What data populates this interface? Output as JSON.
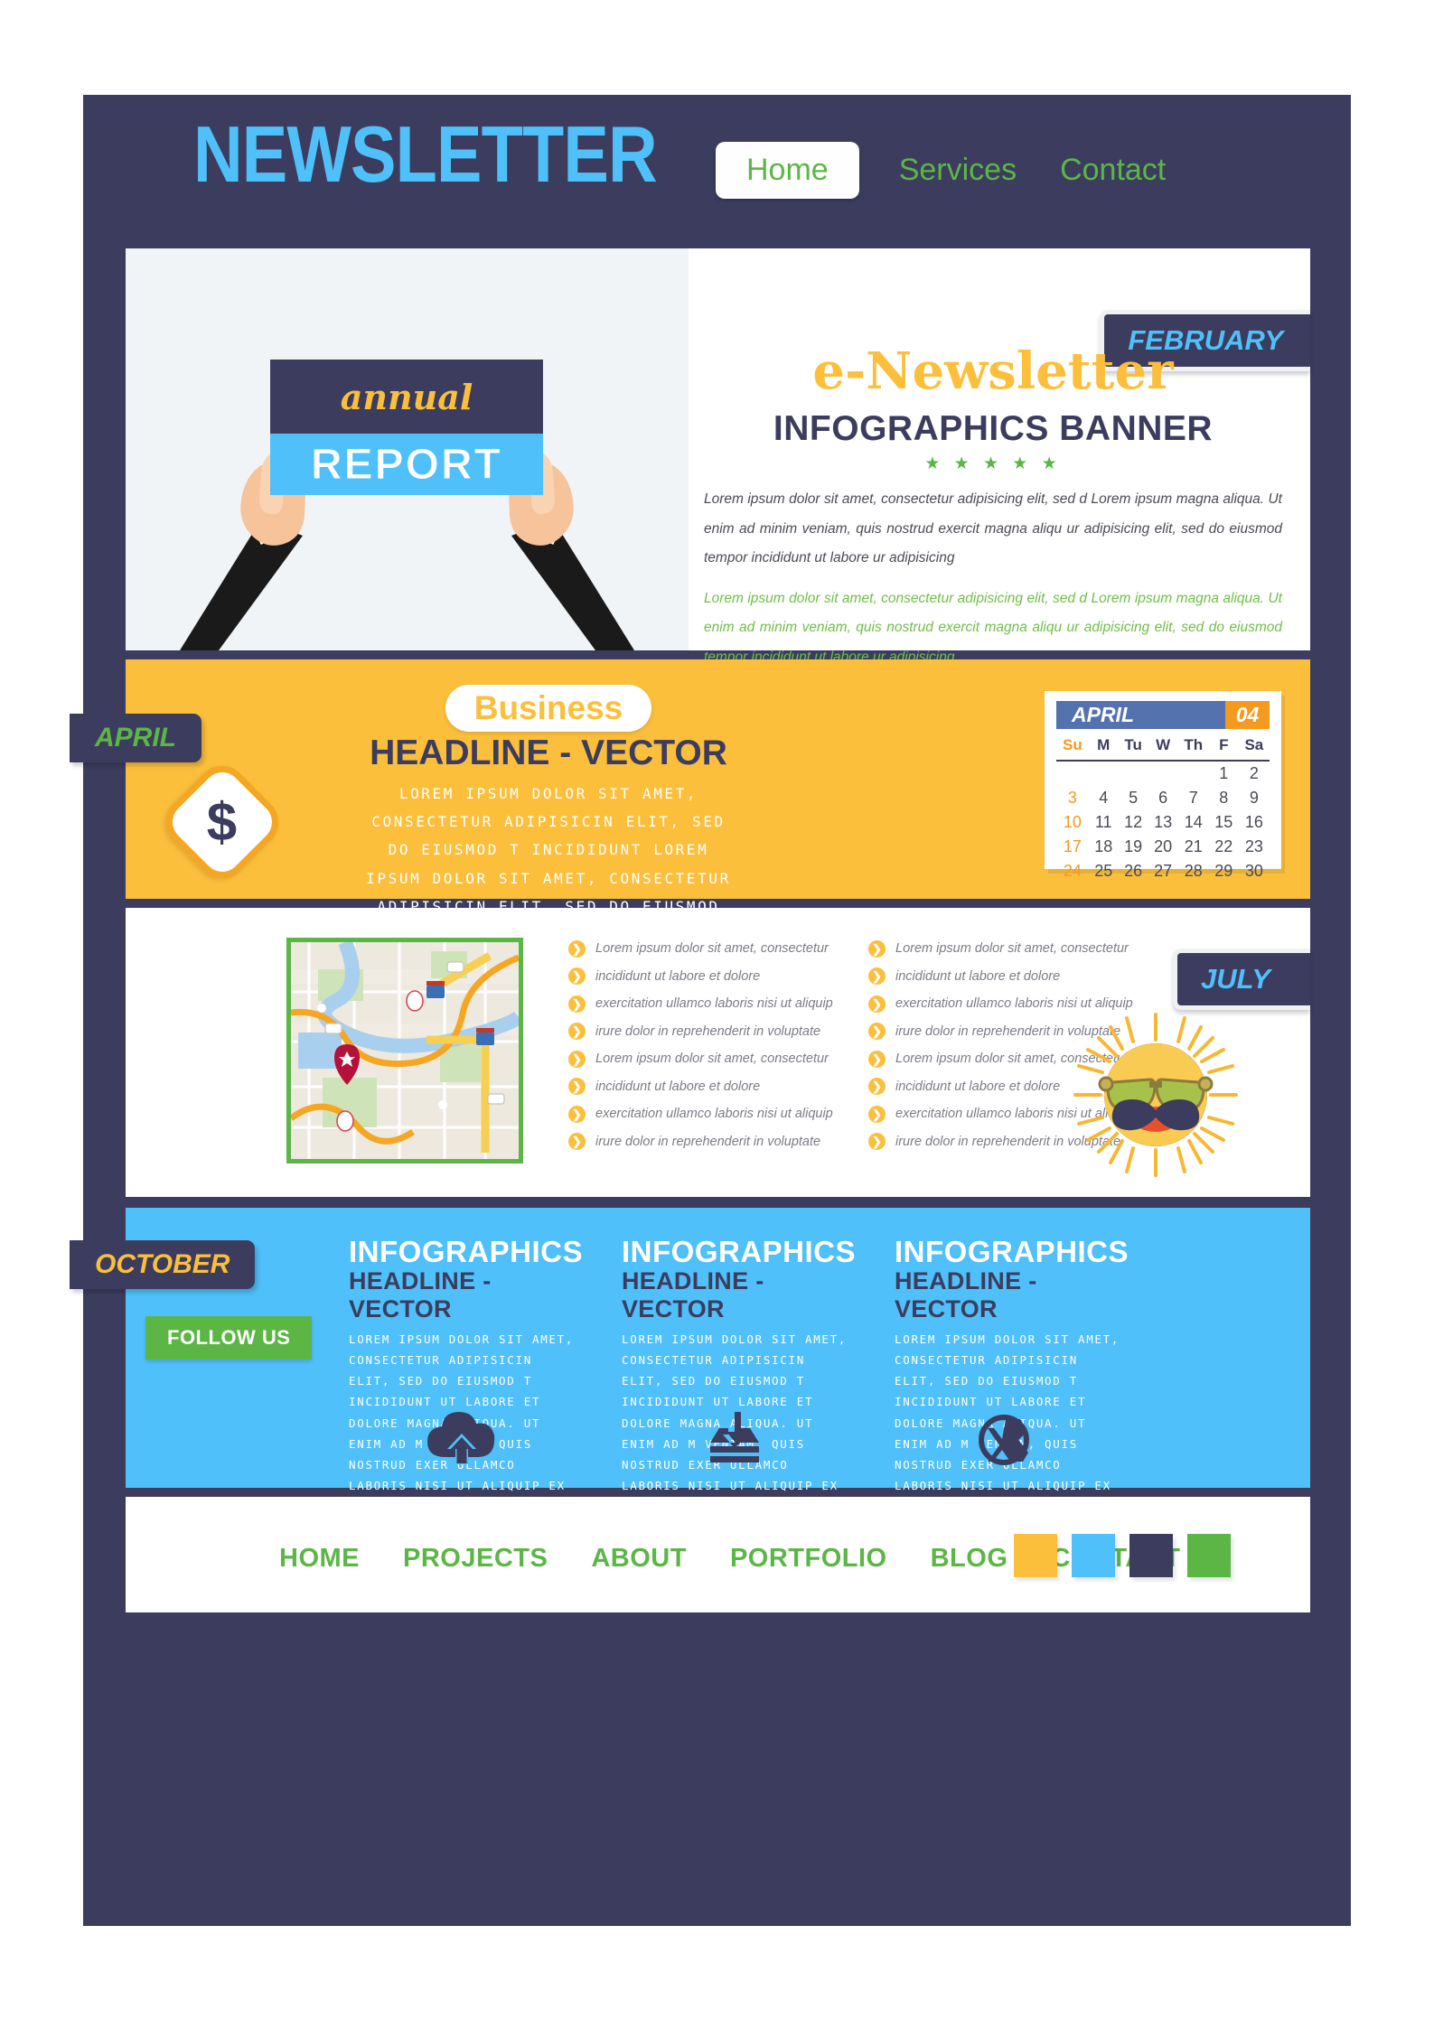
{
  "header": {
    "brand": "NEWSLETTER",
    "nav": [
      {
        "label": "Home",
        "active": true
      },
      {
        "label": "Services",
        "active": false
      },
      {
        "label": "Contact",
        "active": false
      }
    ]
  },
  "hero": {
    "month_tab": "FEBRUARY",
    "poster_script": "annual",
    "poster_title": "REPORT",
    "title": "e-Newsletter",
    "subtitle": "INFOGRAPHICS BANNER",
    "stars": "★ ★ ★ ★ ★",
    "paragraph_dark": "Lorem ipsum dolor sit amet, consectetur adipisicing elit, sed d Lorem ipsum magna aliqua. Ut enim ad minim veniam, quis nostrud exercit magna aliqu ur adipisicing elit, sed do eiusmod tempor incididunt ut labore ur adipisicing",
    "paragraph_green": "Lorem ipsum dolor sit amet, consectetur adipisicing elit, sed d Lorem ipsum magna aliqua. Ut enim ad minim veniam, quis nostrud exercit magna aliqu ur adipisicing elit, sed do eiusmod tempor incididunt ut labore ur adipisicing"
  },
  "business": {
    "month_tab": "APRIL",
    "currency_symbol": "$",
    "pill": "Business",
    "headline": "HEADLINE - VECTOR",
    "paragraph": "Lorem ipsum dolor sit amet, consectetur adipisicin elit, sed do eiusmod t incididunt Lorem ipsum dolor sit amet, consectetur adipisicin elit, sed do eiusmod"
  },
  "calendar": {
    "month": "APRIL",
    "number": "04",
    "weekdays": [
      "Su",
      "M",
      "Tu",
      "W",
      "Th",
      "F",
      "Sa"
    ],
    "weeks": [
      [
        "",
        "",
        "",
        "",
        "",
        "1",
        "2"
      ],
      [
        "3",
        "4",
        "5",
        "6",
        "7",
        "8",
        "9"
      ],
      [
        "10",
        "11",
        "12",
        "13",
        "14",
        "15",
        "16"
      ],
      [
        "17",
        "18",
        "19",
        "20",
        "21",
        "22",
        "23"
      ],
      [
        "24",
        "25",
        "26",
        "27",
        "28",
        "29",
        "30"
      ]
    ]
  },
  "list_section": {
    "month_tab": "JULY",
    "column_left": [
      "Lorem ipsum dolor sit amet, consectetur",
      "incididunt ut labore et dolore",
      "exercitation ullamco laboris nisi ut aliquip",
      "irure dolor in reprehenderit in voluptate",
      "Lorem ipsum dolor sit amet, consectetur",
      "incididunt ut labore et dolore",
      "exercitation ullamco laboris nisi ut aliquip",
      "irure dolor in reprehenderit in voluptate"
    ],
    "column_right": [
      "Lorem ipsum dolor sit amet, consectetur",
      "incididunt ut labore et dolore",
      "exercitation ullamco laboris nisi ut aliquip",
      "irure dolor in reprehenderit in voluptate",
      "Lorem ipsum dolor sit amet, consectetur",
      "incididunt ut labore et dolore",
      "exercitation ullamco laboris nisi ut aliquip",
      "irure dolor in reprehenderit in voluptate"
    ],
    "bullet_glyph": "❯"
  },
  "infographics": {
    "month_tab": "OCTOBER",
    "follow_label": "FOLLOW US",
    "columns": [
      {
        "title": "INFOGRAPHICS",
        "subtitle": "HEADLINE - VECTOR",
        "paragraph": "Lorem ipsum dolor sit amet, consectetur adipisicin elit, sed do eiusmod t incididunt ut labore et dolore magna aliqua. Ut enim ad m veniam, quis nostrud exer ullamco laboris nisi ut aliquip ex ea commodo",
        "icon": "cloud-upload-icon"
      },
      {
        "title": "INFOGRAPHICS",
        "subtitle": "HEADLINE - VECTOR",
        "paragraph": "Lorem ipsum dolor sit amet, consectetur adipisicin elit, sed do eiusmod t incididunt ut labore et dolore magna aliqua. Ut enim ad m veniam, quis nostrud exer ullamco laboris nisi ut aliquip ex ea commodo",
        "icon": "inbox-download-icon"
      },
      {
        "title": "INFOGRAPHICS",
        "subtitle": "HEADLINE - VECTOR",
        "paragraph": "Lorem ipsum dolor sit amet, consectetur adipisicin elit, sed do eiusmod t incididunt ut labore et dolore magna aliqua. Ut enim ad m veniam, quis nostrud exer ullamco laboris nisi ut aliquip ex ea commodo",
        "icon": "circle-x-icon"
      }
    ]
  },
  "footer": {
    "links": [
      "HOME",
      "PROJECTS",
      "ABOUT",
      "PORTFOLIO",
      "BLOG",
      "CONTACT"
    ],
    "swatches": [
      "#FBBF3C",
      "#4FC0FA",
      "#3C3D5E",
      "#5CB646"
    ]
  },
  "palette": {
    "navy": "#3C3D5E",
    "amber": "#FBBF3C",
    "sky": "#4FC0FA",
    "green": "#5CB646"
  }
}
